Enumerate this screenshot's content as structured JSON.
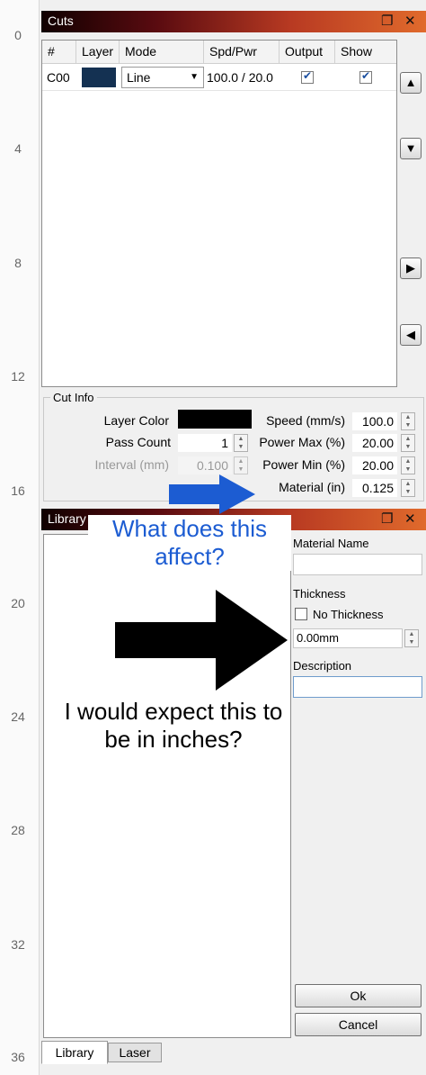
{
  "ruler": {
    "marks": [
      "0",
      "4",
      "8",
      "12",
      "16",
      "20",
      "24",
      "28",
      "32",
      "36"
    ]
  },
  "cuts_panel": {
    "title": "Cuts",
    "columns": [
      "#",
      "Layer",
      "Mode",
      "Spd/Pwr",
      "Output",
      "Show"
    ],
    "rows": [
      {
        "id": "C00",
        "layer_color": "#143152",
        "mode": "Line",
        "spd_pwr": "100.0 / 20.0",
        "output": true,
        "show": true
      }
    ],
    "side_buttons": [
      "up-icon",
      "down-icon",
      "right-icon",
      "left-icon"
    ]
  },
  "cut_info": {
    "title": "Cut Info",
    "layer_color_label": "Layer Color",
    "layer_color_value": "#000000",
    "pass_count_label": "Pass Count",
    "pass_count_value": "1",
    "interval_label": "Interval (mm)",
    "interval_value": "0.100",
    "speed_label": "Speed (mm/s)",
    "speed_value": "100.0",
    "power_max_label": "Power Max (%)",
    "power_max_value": "20.00",
    "power_min_label": "Power Min (%)",
    "power_min_value": "20.00",
    "material_label": "Material (in)",
    "material_value": "0.125"
  },
  "library_panel": {
    "title": "Library",
    "material_name_label": "Material Name",
    "material_name_value": "",
    "thickness_label": "Thickness",
    "no_thickness_label": "No Thickness",
    "no_thickness_checked": false,
    "thickness_value": "0.00mm",
    "description_label": "Description",
    "description_value": "",
    "ok_label": "Ok",
    "cancel_label": "Cancel",
    "tabs": [
      "Library",
      "Laser"
    ],
    "active_tab": "Library"
  },
  "annotations": {
    "blue_text": "What does this affect?",
    "blue_color": "#1c5cd2",
    "black_text": "I would expect this to be in inches?"
  },
  "colors": {
    "titlebar_start": "#100000",
    "titlebar_end": "#e06a2c"
  }
}
